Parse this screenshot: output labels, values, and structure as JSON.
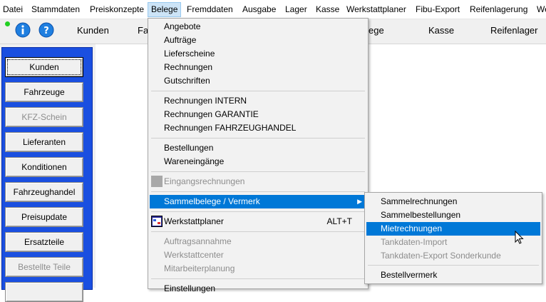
{
  "menubar": {
    "items": [
      {
        "label": "Datei"
      },
      {
        "label": "Stammdaten"
      },
      {
        "label": "Preiskonzepte"
      },
      {
        "label": "Belege"
      },
      {
        "label": "Fremddaten"
      },
      {
        "label": "Ausgabe"
      },
      {
        "label": "Lager"
      },
      {
        "label": "Kasse"
      },
      {
        "label": "Werkstattplaner"
      },
      {
        "label": "Fibu-Export"
      },
      {
        "label": "Reifenlagerung"
      },
      {
        "label": "We"
      }
    ]
  },
  "toolbar": {
    "items": [
      {
        "label": "Kunden"
      },
      {
        "label": "Fa"
      },
      {
        "label": "ege"
      },
      {
        "label": "Kasse"
      },
      {
        "label": "Reifenlager"
      }
    ]
  },
  "sidebar": {
    "buttons": [
      {
        "label": "Kunden"
      },
      {
        "label": "Fahrzeuge"
      },
      {
        "label": "KFZ-Schein"
      },
      {
        "label": "Lieferanten"
      },
      {
        "label": "Konditionen"
      },
      {
        "label": "Fahrzeughandel"
      },
      {
        "label": "Preisupdate"
      },
      {
        "label": "Ersatzteile"
      },
      {
        "label": "Bestellte Teile"
      }
    ]
  },
  "belege_menu": {
    "items": [
      {
        "label": "Angebote"
      },
      {
        "label": "Aufträge"
      },
      {
        "label": "Lieferscheine"
      },
      {
        "label": "Rechnungen"
      },
      {
        "label": "Gutschriften"
      },
      {
        "label": "Rechnungen INTERN"
      },
      {
        "label": "Rechnungen GARANTIE"
      },
      {
        "label": "Rechnungen FAHRZEUGHANDEL"
      },
      {
        "label": "Bestellungen"
      },
      {
        "label": "Wareneingänge"
      },
      {
        "label": "Eingangsrechnungen"
      },
      {
        "label": "Sammelbelege / Vermerk"
      },
      {
        "label": "Werkstattplaner",
        "shortcut": "ALT+T"
      },
      {
        "label": "Auftragsannahme"
      },
      {
        "label": "Werkstattcenter"
      },
      {
        "label": "Mitarbeiterplanung"
      },
      {
        "label": "Einstellungen"
      }
    ]
  },
  "submenu": {
    "items": [
      {
        "label": "Sammelrechnungen"
      },
      {
        "label": "Sammelbestellungen"
      },
      {
        "label": "Mietrechnungen"
      },
      {
        "label": "Tankdaten-Import"
      },
      {
        "label": "Tankdaten-Export Sonderkunde"
      },
      {
        "label": "Bestellvermerk"
      }
    ]
  },
  "colors": {
    "highlight": "#0078d7",
    "sidebar_blue": "#1a4fe0",
    "menu_bg": "#f2f2f2",
    "disabled_text": "#8d8d8d"
  }
}
